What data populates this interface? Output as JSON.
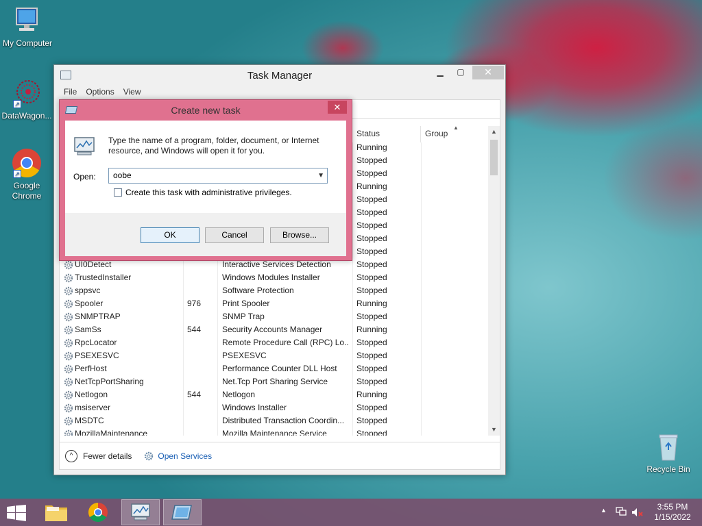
{
  "desktop": {
    "icons": [
      {
        "label": "My Computer"
      },
      {
        "label": "DataWagon..."
      },
      {
        "label": "Google Chrome"
      },
      {
        "label": "Recycle Bin"
      }
    ]
  },
  "task_manager": {
    "title": "Task Manager",
    "menu": [
      "File",
      "Options",
      "View"
    ],
    "columns": {
      "status": "Status",
      "group": "Group"
    },
    "hidden_statuses": [
      "Running",
      "Stopped",
      "Stopped",
      "Running",
      "Stopped",
      "Stopped",
      "Stopped",
      "Stopped",
      "Stopped"
    ],
    "rows": [
      {
        "name": "UI0Detect",
        "pid": "",
        "description": "Interactive Services Detection",
        "status": "Stopped"
      },
      {
        "name": "TrustedInstaller",
        "pid": "",
        "description": "Windows Modules Installer",
        "status": "Stopped"
      },
      {
        "name": "sppsvc",
        "pid": "",
        "description": "Software Protection",
        "status": "Stopped"
      },
      {
        "name": "Spooler",
        "pid": "976",
        "description": "Print Spooler",
        "status": "Running"
      },
      {
        "name": "SNMPTRAP",
        "pid": "",
        "description": "SNMP Trap",
        "status": "Stopped"
      },
      {
        "name": "SamSs",
        "pid": "544",
        "description": "Security Accounts Manager",
        "status": "Running"
      },
      {
        "name": "RpcLocator",
        "pid": "",
        "description": "Remote Procedure Call (RPC) Lo...",
        "status": "Stopped"
      },
      {
        "name": "PSEXESVC",
        "pid": "",
        "description": "PSEXESVC",
        "status": "Stopped"
      },
      {
        "name": "PerfHost",
        "pid": "",
        "description": "Performance Counter DLL Host",
        "status": "Stopped"
      },
      {
        "name": "NetTcpPortSharing",
        "pid": "",
        "description": "Net.Tcp Port Sharing Service",
        "status": "Stopped"
      },
      {
        "name": "Netlogon",
        "pid": "544",
        "description": "Netlogon",
        "status": "Running"
      },
      {
        "name": "msiserver",
        "pid": "",
        "description": "Windows Installer",
        "status": "Stopped"
      },
      {
        "name": "MSDTC",
        "pid": "",
        "description": "Distributed Transaction Coordin...",
        "status": "Stopped"
      },
      {
        "name": "MozillaMaintenance",
        "pid": "",
        "description": "Mozilla Maintenance Service",
        "status": "Stopped"
      }
    ],
    "footer": {
      "fewer_details": "Fewer details",
      "open_services": "Open Services"
    }
  },
  "create_task_dialog": {
    "title": "Create new task",
    "message": "Type the name of a program, folder, document, or Internet resource, and Windows will open it for you.",
    "open_label": "Open:",
    "open_value": "oobe",
    "admin_checkbox_label": "Create this task with administrative privileges.",
    "buttons": {
      "ok": "OK",
      "cancel": "Cancel",
      "browse": "Browse..."
    }
  },
  "taskbar": {
    "clock_time": "3:55 PM",
    "clock_date": "1/15/2022"
  },
  "colors": {
    "dialog_frame": "#e0718f",
    "dialog_close": "#c8455f",
    "taskbar": "#78506e",
    "link": "#1a5fb4"
  }
}
